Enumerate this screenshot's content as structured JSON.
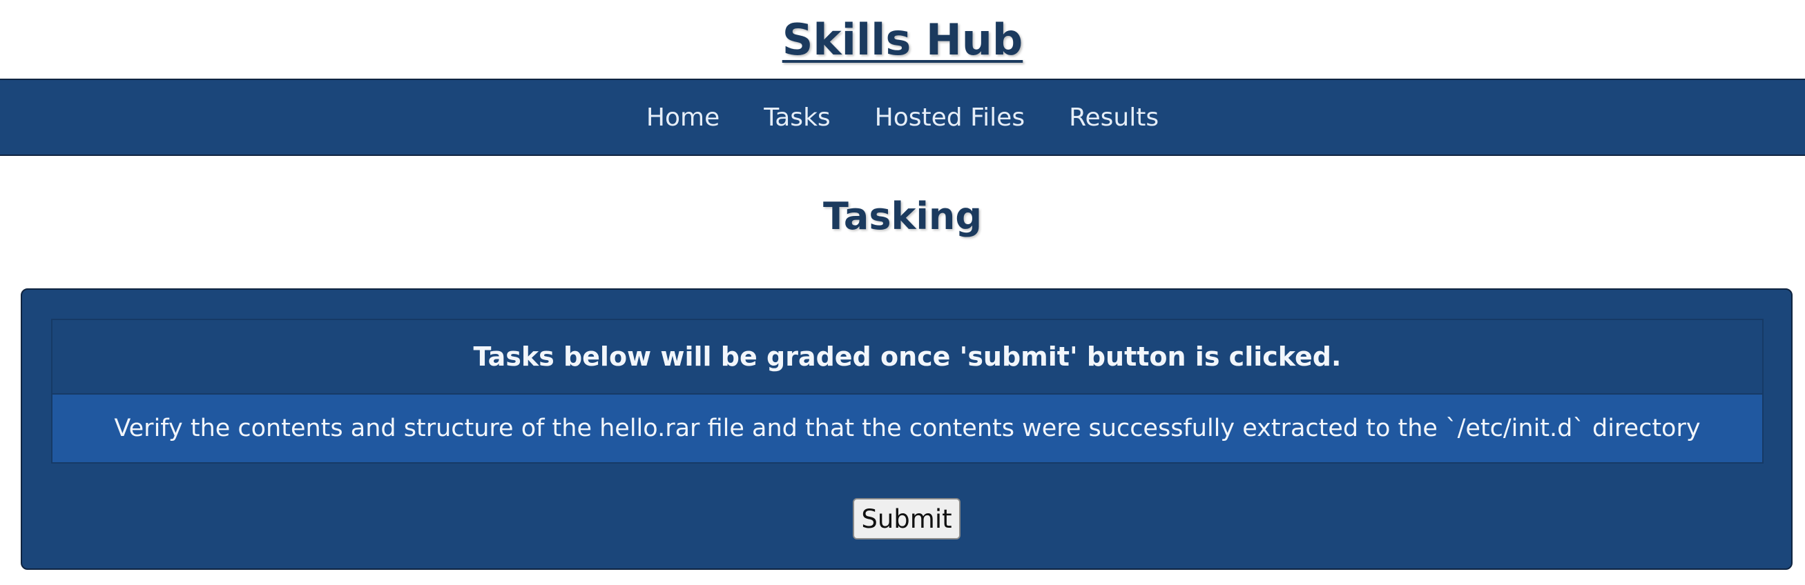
{
  "header": {
    "title": "Skills Hub"
  },
  "nav": {
    "items": [
      {
        "label": "Home"
      },
      {
        "label": "Tasks"
      },
      {
        "label": "Hosted Files"
      },
      {
        "label": "Results"
      }
    ]
  },
  "main": {
    "heading": "Tasking",
    "panel": {
      "instruction": "Tasks below will be graded once 'submit' button is clicked.",
      "tasks": [
        {
          "text": "Verify the contents and structure of the hello.rar file and that the contents were successfully extracted to the `/etc/init.d` directory"
        }
      ],
      "submit_label": "Submit"
    }
  },
  "colors": {
    "brand_dark": "#1b3a5e",
    "nav_background": "#1b467a",
    "task_row_background": "#2058a0",
    "text_light": "#f2f6fb"
  }
}
